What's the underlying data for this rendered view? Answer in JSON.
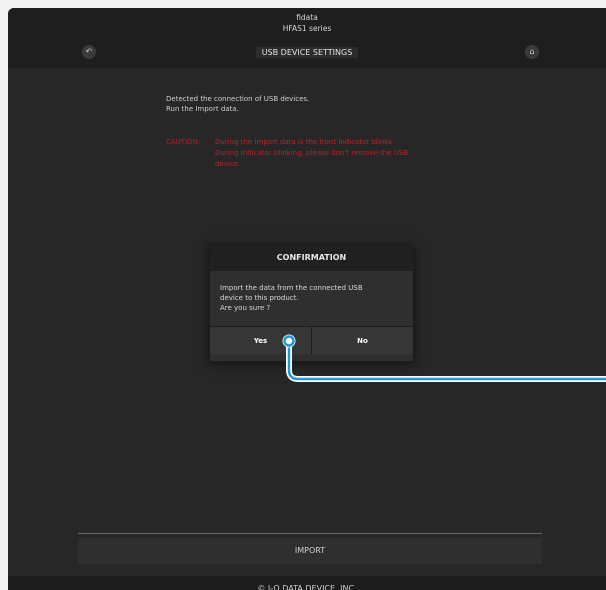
{
  "app": {
    "brand_line1": "fidata",
    "brand_line2": "HFAS1 series"
  },
  "header": {
    "title": "USB DEVICE SETTINGS",
    "back_icon": "back-arrow-icon",
    "home_icon": "home-icon"
  },
  "main": {
    "message_line1": "Detected the connection of USB devices.",
    "message_line2": "Run the Import data.",
    "caution_label": "CAUTION:",
    "caution_line1": "During the Import data is the front Indicator blinks.",
    "caution_line2": "During Indicator blinking, please don't remove the USB",
    "caution_line3": "device."
  },
  "dialog": {
    "title": "CONFIRMATION",
    "body_line1": "Import the data from the connected USB",
    "body_line2": "device to this product.",
    "body_line3": "Are you sure ?",
    "yes_label": "Yes",
    "no_label": "No"
  },
  "bottom": {
    "import_label": "IMPORT"
  },
  "footer": {
    "copyright": "© I-O DATA DEVICE, INC."
  },
  "colors": {
    "background": "#272727",
    "caution": "#b3262a",
    "callout": "#1a9bd7"
  }
}
